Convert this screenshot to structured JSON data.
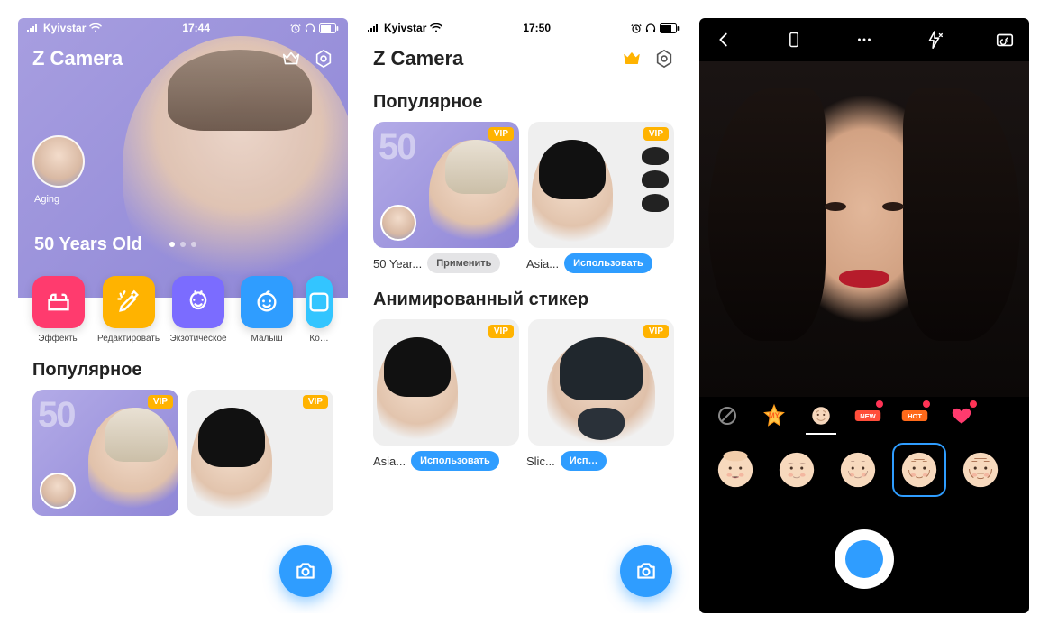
{
  "screen1": {
    "status": {
      "carrier": "Kyivstar",
      "time": "17:44"
    },
    "app_title": "Z Camera",
    "hero": {
      "mini_label": "Aging",
      "age_label": "50 Years Old"
    },
    "tools": [
      {
        "label": "Эффекты",
        "color": "#ff3b6e"
      },
      {
        "label": "Редактировать",
        "color": "#ffb300"
      },
      {
        "label": "Экзотическое",
        "color": "#7b6cff"
      },
      {
        "label": "Малыш",
        "color": "#2f9dff"
      },
      {
        "label": "Ко…",
        "color": "#33c5ff"
      }
    ],
    "section_popular": "Популярное",
    "cards": [
      {
        "vip": "VIP"
      },
      {
        "vip": "VIP"
      }
    ]
  },
  "screen2": {
    "status": {
      "carrier": "Kyivstar",
      "time": "17:50"
    },
    "app_title": "Z Camera",
    "section_popular": "Популярное",
    "popular": [
      {
        "name": "50 Year...",
        "btn": "Применить",
        "btn_style": "gray",
        "vip": "VIP"
      },
      {
        "name": "Asia...",
        "btn": "Использовать",
        "btn_style": "blue",
        "vip": "VIP"
      }
    ],
    "section_sticker": "Анимированный стикер",
    "sticker": [
      {
        "name": "Asia...",
        "btn": "Использовать",
        "btn_style": "blue",
        "vip": "VIP"
      },
      {
        "name": "Slic...",
        "btn": "Исп…",
        "btn_style": "blue",
        "vip": "VIP"
      }
    ]
  },
  "screen3": {
    "cats": [
      {
        "name": "none-icon"
      },
      {
        "name": "my-star-icon",
        "label": "MY"
      },
      {
        "name": "aging-category-icon",
        "active": true
      },
      {
        "name": "new-tag-icon",
        "label": "NEW",
        "dot": true
      },
      {
        "name": "hot-tag-icon",
        "label": "HOT",
        "dot": true
      },
      {
        "name": "heart-icon",
        "dot": true
      }
    ],
    "heads_selected_index": 3
  }
}
